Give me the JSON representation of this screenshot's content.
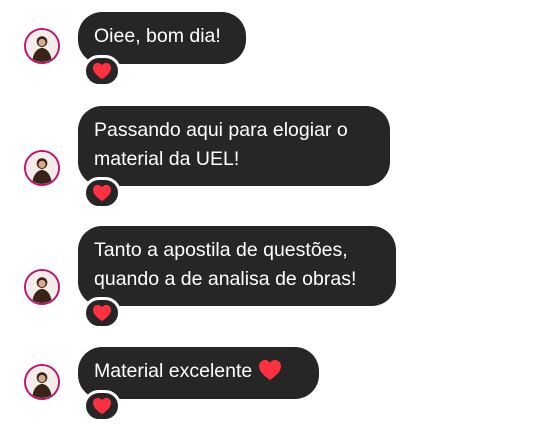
{
  "chat": {
    "messages": [
      {
        "lines": [
          "Oiee, bom dia!"
        ],
        "reaction": "red-heart-emoji"
      },
      {
        "lines": [
          "Passando aqui para elogiar o",
          "material da UEL!"
        ],
        "reaction": "red-heart-emoji"
      },
      {
        "lines": [
          "Tanto a apostila de questões,",
          "quando a de analisa de obras!"
        ],
        "reaction": "red-heart-emoji"
      },
      {
        "lines": [
          "Material excelente"
        ],
        "inline_emoji": "red-heart-emoji",
        "reaction": "red-heart-emoji"
      }
    ]
  },
  "colors": {
    "bubble": "#262626",
    "text": "#ffffff",
    "heart": "#ff3040",
    "avatar_ring": "#c0126f"
  }
}
